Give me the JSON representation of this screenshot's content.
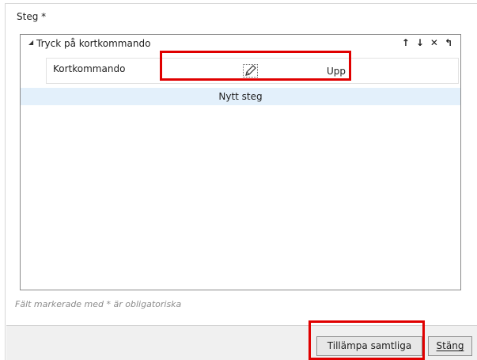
{
  "steps": {
    "label": "Steg *",
    "step": {
      "title": "Tryck på kortkommando",
      "actions": [
        "↑",
        "↓",
        "✕",
        "↰"
      ],
      "param_label": "Kortkommando",
      "param_value": "Upp"
    },
    "new_step": "Nytt steg"
  },
  "required_note": "Fält markerade med * är obligatoriska",
  "footer": {
    "apply_label": "Tillämpa samtliga",
    "close_label": "Stäng"
  },
  "colors": {
    "highlight": "#e00000",
    "new_step_bg": "#e3f0fb"
  }
}
